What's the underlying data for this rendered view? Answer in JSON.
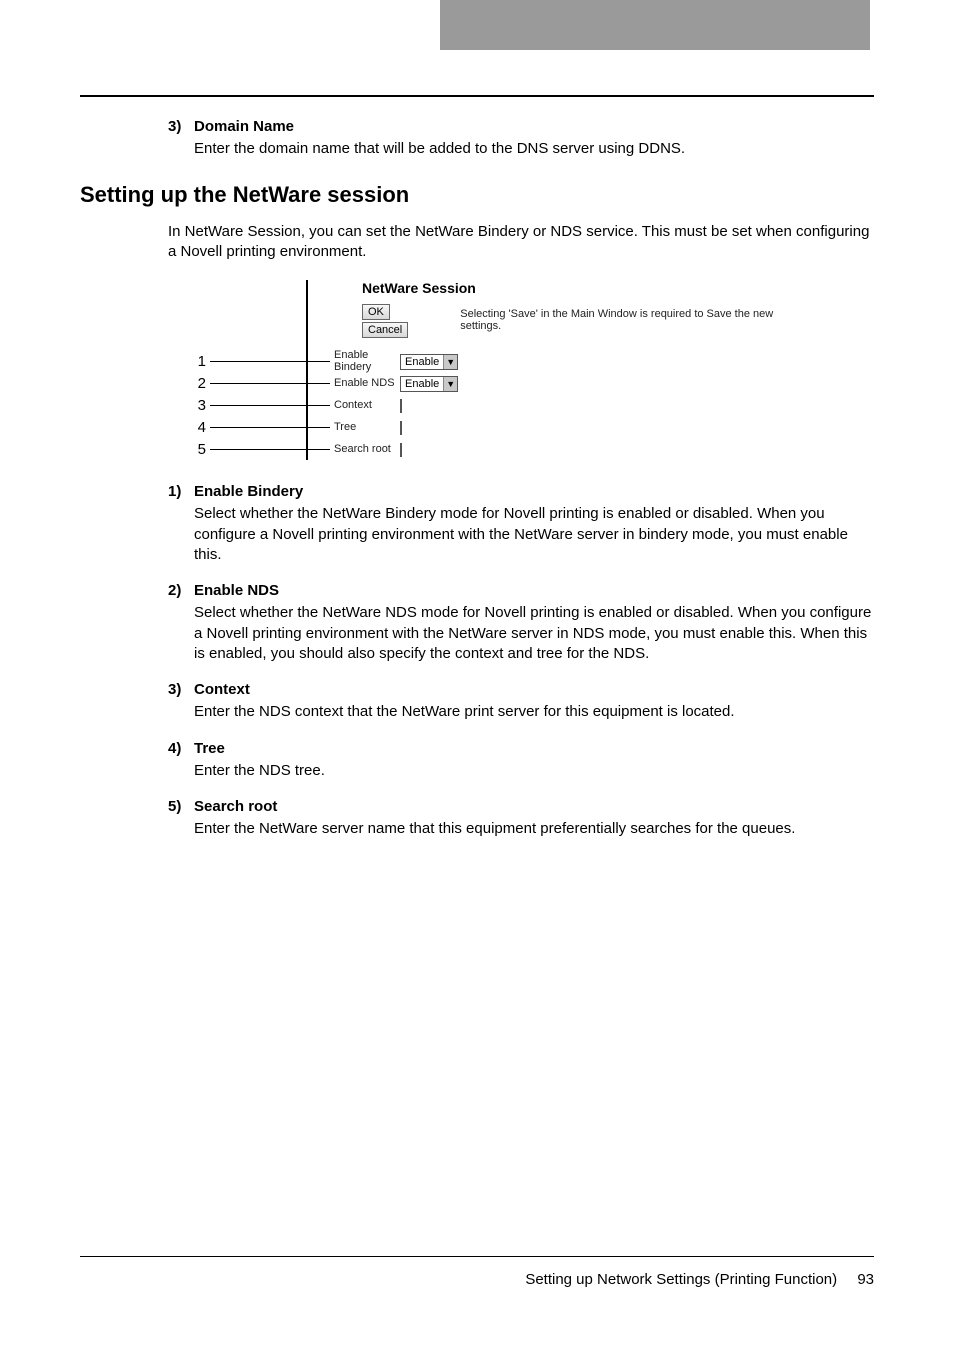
{
  "top_item": {
    "num": "3)",
    "title": "Domain Name",
    "desc": "Enter the domain name that will be added to the DNS server using DDNS."
  },
  "section_heading": "Setting up the NetWare session",
  "section_intro": "In NetWare Session, you can set the NetWare Bindery or NDS service.  This must be set when configuring a Novell printing environment.",
  "figure": {
    "title": "NetWare Session",
    "ok": "OK",
    "cancel": "Cancel",
    "note": "Selecting 'Save' in the Main Window is required to Save the new settings.",
    "rows": {
      "r1": {
        "num": "1",
        "label": "Enable Bindery",
        "value": "Enable"
      },
      "r2": {
        "num": "2",
        "label": "Enable NDS",
        "value": "Enable"
      },
      "r3": {
        "num": "3",
        "label": "Context"
      },
      "r4": {
        "num": "4",
        "label": "Tree"
      },
      "r5": {
        "num": "5",
        "label": "Search root"
      }
    }
  },
  "items": {
    "i1": {
      "num": "1)",
      "title": "Enable Bindery",
      "desc": "Select whether the NetWare Bindery mode for Novell printing is enabled or disabled.  When you configure a Novell printing environment with the NetWare server in bindery mode, you must enable this."
    },
    "i2": {
      "num": "2)",
      "title": "Enable NDS",
      "desc": "Select whether the NetWare NDS mode for Novell printing is enabled or disabled.  When you configure a Novell printing environment with the NetWare server in NDS mode, you must enable this.  When this is enabled, you should also specify the context and tree for the NDS."
    },
    "i3": {
      "num": "3)",
      "title": "Context",
      "desc": "Enter the NDS context that the NetWare print server for this equipment is located."
    },
    "i4": {
      "num": "4)",
      "title": "Tree",
      "desc": "Enter the NDS tree."
    },
    "i5": {
      "num": "5)",
      "title": "Search root",
      "desc": "Enter the NetWare server name that this equipment preferentially searches for the queues."
    }
  },
  "footer": {
    "text": "Setting up Network Settings (Printing Function)",
    "page": "93"
  }
}
